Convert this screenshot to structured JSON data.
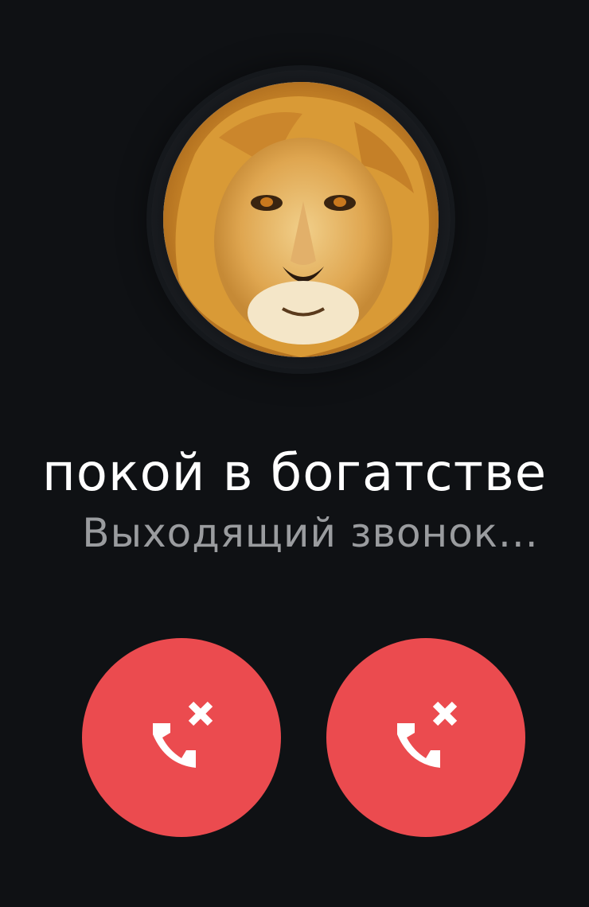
{
  "contact": {
    "name": "покой в богатстве",
    "avatar_icon": "lion-avatar"
  },
  "call": {
    "status": "Выходящий звонок..."
  },
  "actions": [
    {
      "icon": "call-end-icon",
      "color": "#eb4b4f"
    },
    {
      "icon": "call-end-icon",
      "color": "#eb4b4f"
    }
  ],
  "colors": {
    "background": "#0f1114",
    "end_call": "#eb4b4f",
    "name_text": "#ffffff",
    "status_text": "#9a9c9f"
  }
}
